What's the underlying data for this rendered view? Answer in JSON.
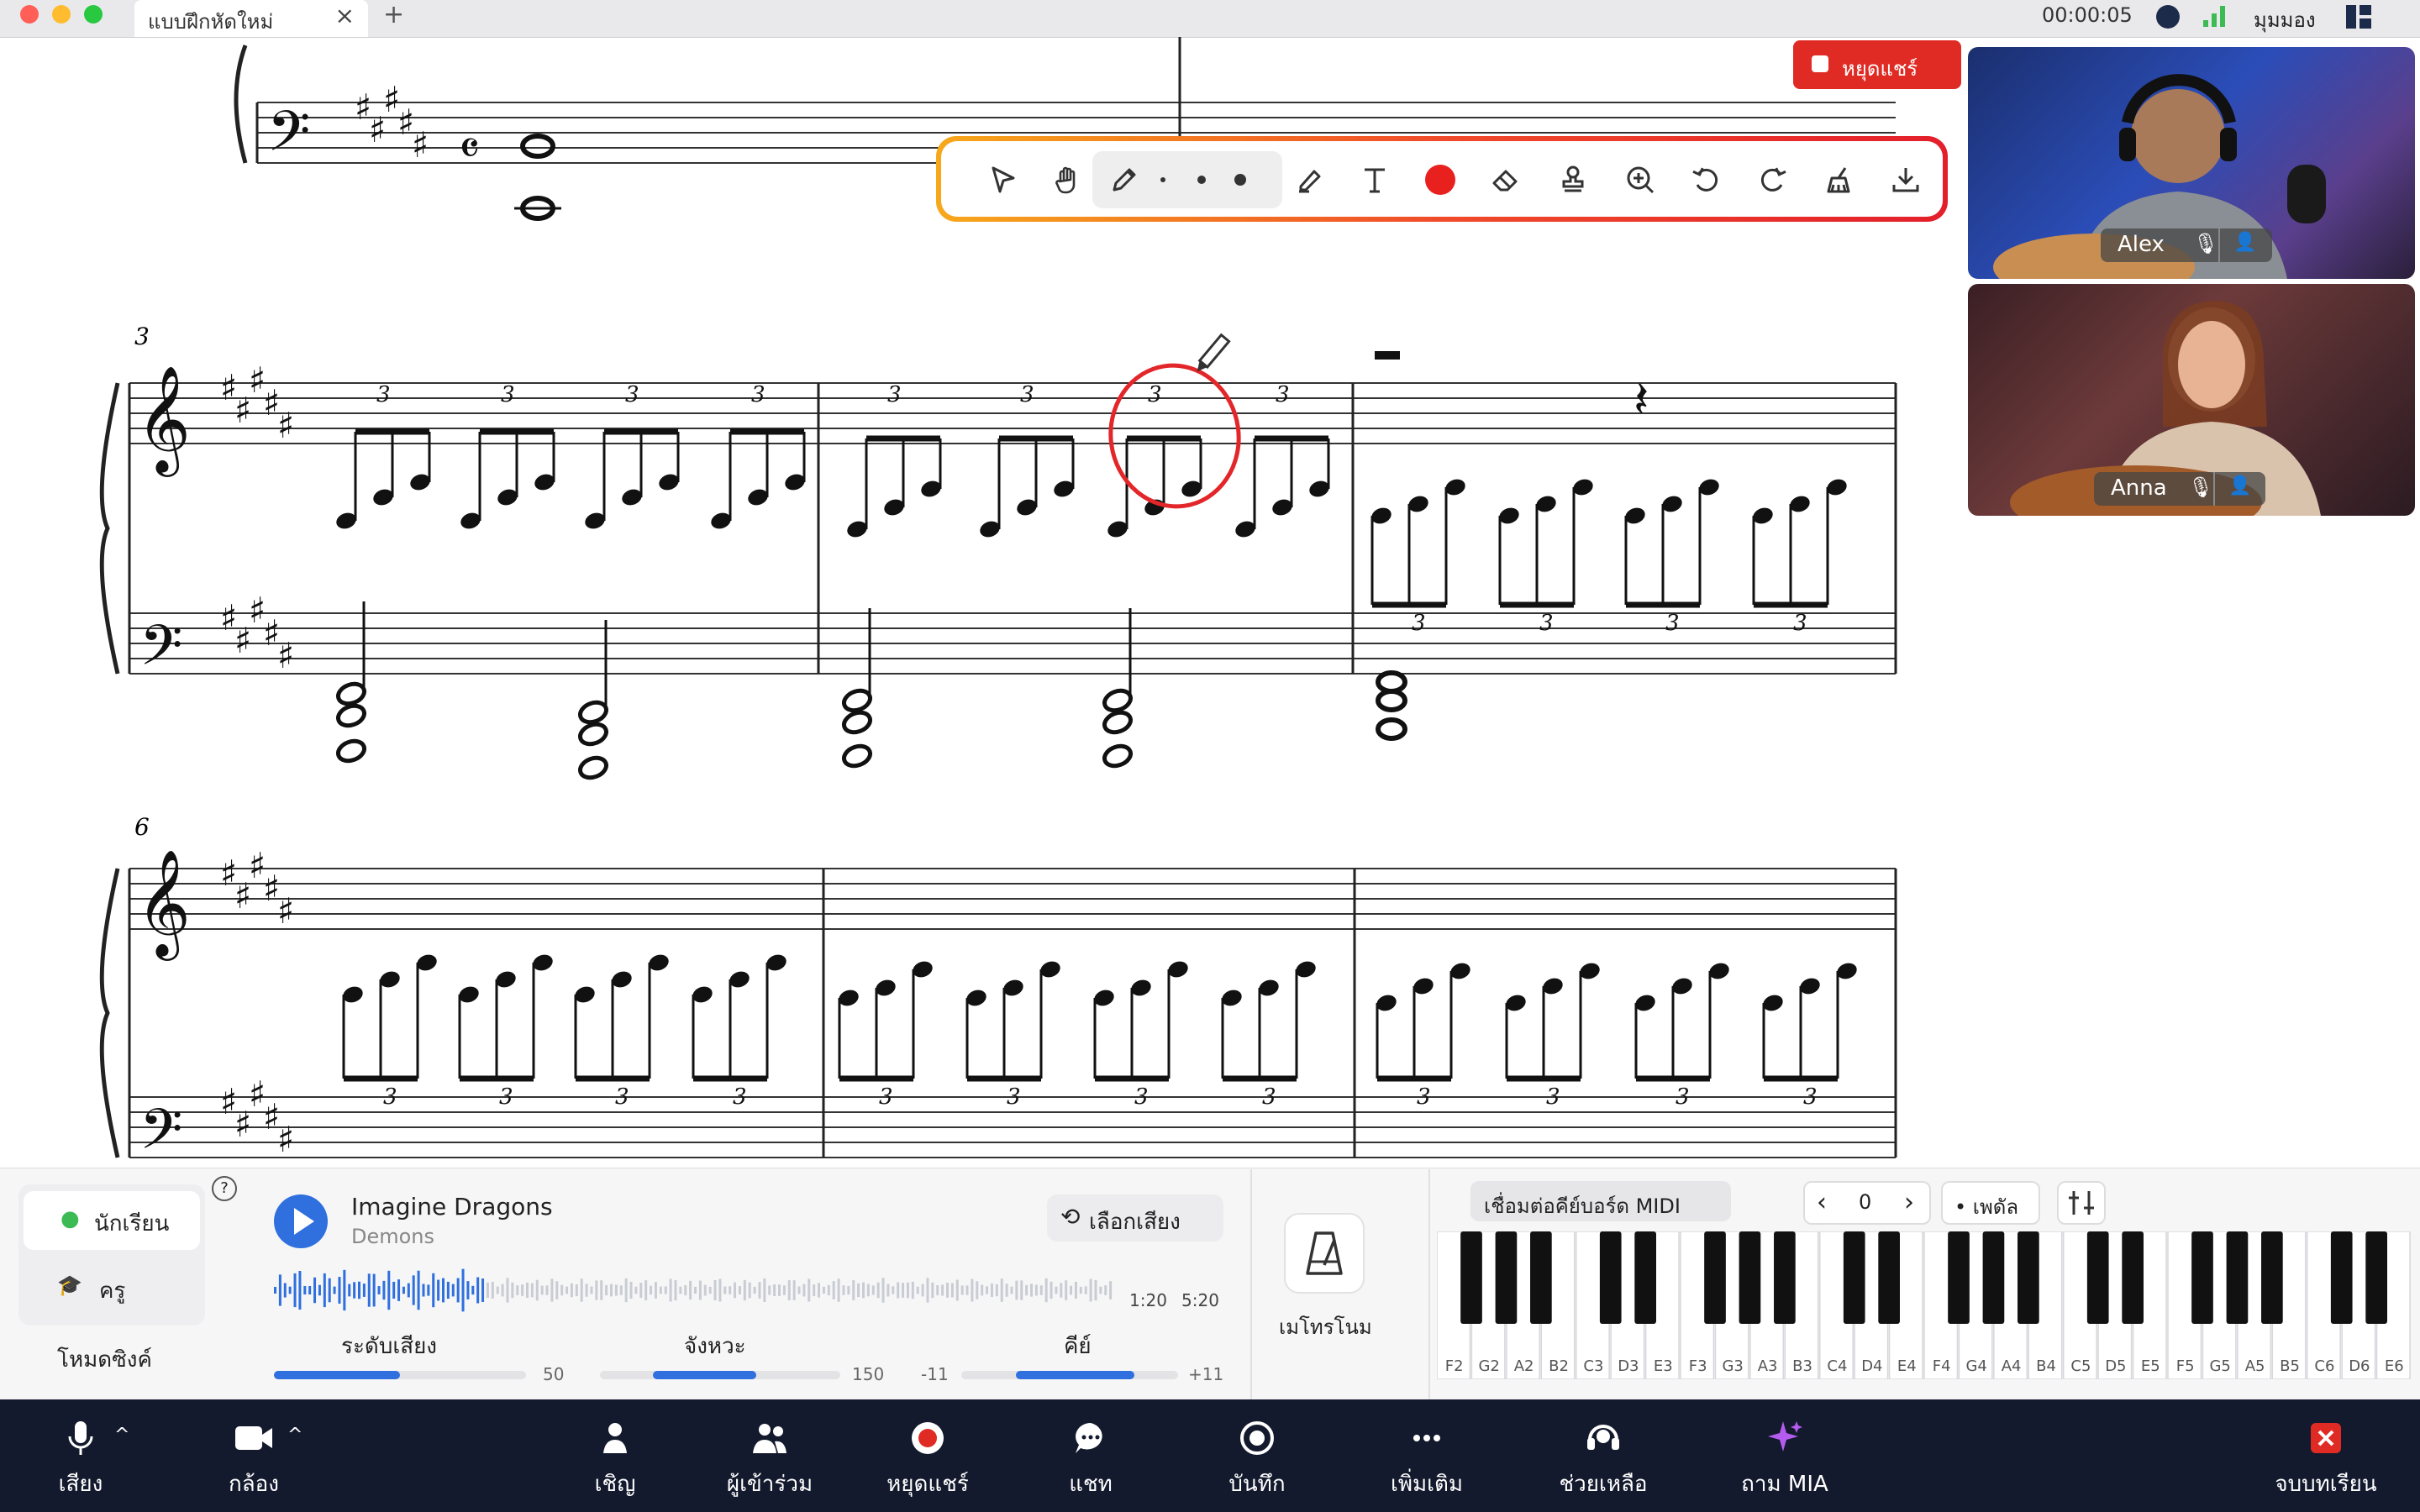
{
  "window": {
    "tab_title": "แบบฝึกหัดใหม่",
    "tab_close": "×",
    "new_tab": "+",
    "timer": "00:00:05",
    "view_label": "มุมมอง"
  },
  "score": {
    "measure_numbers": [
      "3",
      "6"
    ],
    "tuplet_label": "3"
  },
  "share": {
    "stop_label": "หยุดแชร์"
  },
  "toolbar": {
    "tools": [
      "select-arrow",
      "hand-pan",
      "pencil",
      "size-small",
      "size-medium",
      "size-large",
      "highlighter",
      "text",
      "color-red",
      "eraser",
      "stamp",
      "zoom-in",
      "undo",
      "redo",
      "clear-broom",
      "download"
    ],
    "active_color": "#e8211f"
  },
  "participants": [
    {
      "name": "Alex"
    },
    {
      "name": "Anna"
    }
  ],
  "roles": {
    "student": "นักเรียน",
    "teacher": "ครู",
    "sync_mode": "โหมดซิงค์",
    "help": "?"
  },
  "player": {
    "title": "Imagine Dragons",
    "artist": "Demons",
    "voice_select": "เลือกเสียง",
    "current_time": "1:20",
    "total_time": "5:20",
    "progress": 0.25,
    "volume": {
      "label": "ระดับเสียง",
      "value": "50",
      "fraction": 0.5
    },
    "tempo": {
      "label": "จังหวะ",
      "value": "150",
      "fraction": 0.6
    },
    "key": {
      "label": "คีย์",
      "min": "-11",
      "max": "+11",
      "fraction": 0.55
    }
  },
  "metronome": {
    "label": "เมโทรโนม"
  },
  "midi": {
    "connect_label": "เชื่อมต่อคีย์บอร์ด MIDI",
    "octave_prev": "‹",
    "octave_value": "0",
    "octave_next": "›",
    "pedal_label": "• เพดัล",
    "key_labels": [
      "F2",
      "G2",
      "A2",
      "B2",
      "C3",
      "D3",
      "E3",
      "F3",
      "G3",
      "A3",
      "B3",
      "C4",
      "D4",
      "E4",
      "F4",
      "G4",
      "A4",
      "B4",
      "C5",
      "D5",
      "E5",
      "F5",
      "G5",
      "A5",
      "B5",
      "C6",
      "D6",
      "E6"
    ]
  },
  "taskbar": {
    "audio": "เสียง",
    "camera": "กล้อง",
    "invite": "เชิญ",
    "participants": "ผู้เข้าร่วม",
    "stop_share": "หยุดแชร์",
    "chat": "แชท",
    "record": "บันทึก",
    "more": "เพิ่มเติม",
    "help": "ช่วยเหลือ",
    "ask_mia": "ถาม MIA",
    "end_lesson": "จบบทเรียน"
  },
  "colors": {
    "accent_blue": "#2f6fde",
    "danger_red": "#e02b25",
    "taskbar_bg": "#141a2e",
    "mia_purple": "#b45cf0"
  }
}
